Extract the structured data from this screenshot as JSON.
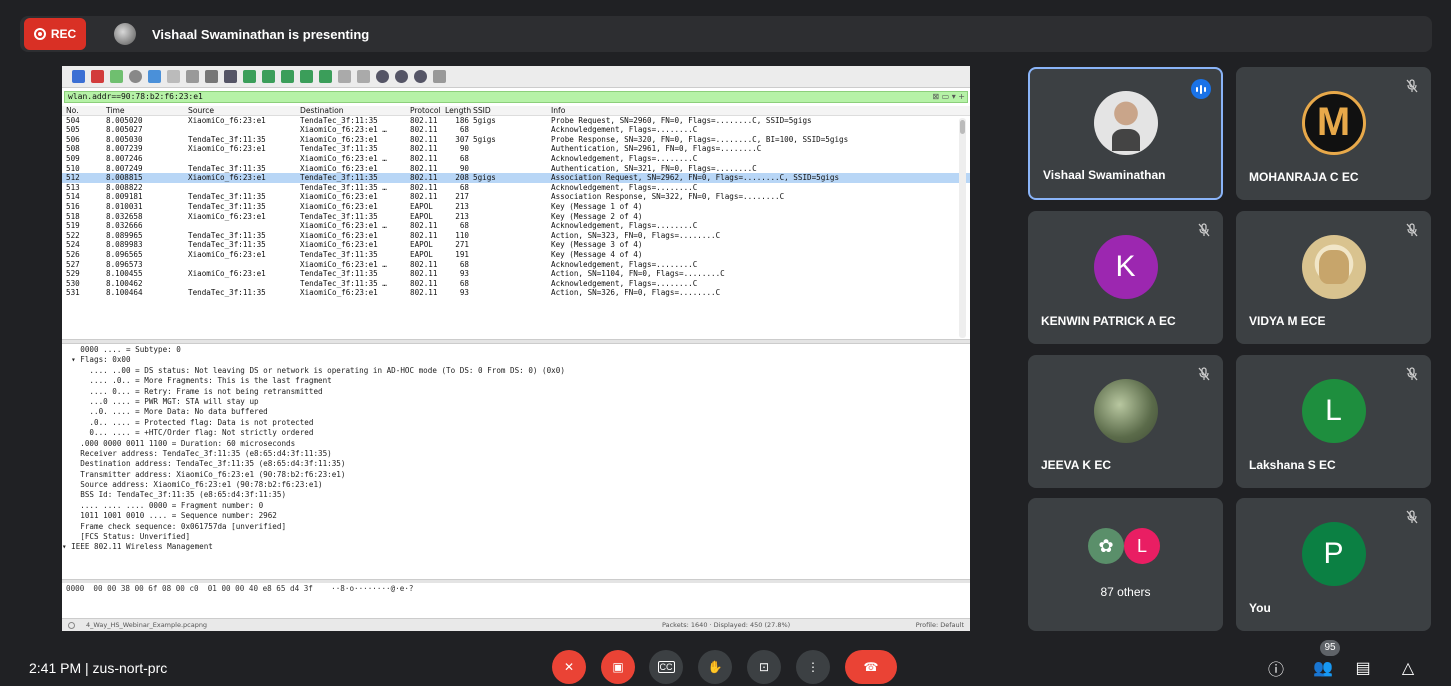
{
  "top_bar": {
    "rec_label": "REC",
    "presenting_text": "Vishaal Swaminathan is presenting"
  },
  "wireshark": {
    "filter": "wlan.addr==90:78:b2:f6:23:e1",
    "filter_end": "⊠ ▭ ▾  +",
    "columns": [
      "No.",
      "Time",
      "Source",
      "Destination",
      "Protocol",
      "Length",
      "SSID",
      "Info"
    ],
    "packets": [
      [
        "504",
        "8.005020",
        "XiaomiCo_f6:23:e1",
        "TendaTec_3f:11:35",
        "802.11",
        "186",
        "5gigs",
        "Probe Request, SN=2960, FN=0, Flags=........C, SSID=5gigs"
      ],
      [
        "505",
        "8.005027",
        "",
        "XiaomiCo_f6:23:e1 …",
        "802.11",
        "68",
        "",
        "Acknowledgement, Flags=........C"
      ],
      [
        "506",
        "8.005030",
        "TendaTec_3f:11:35",
        "XiaomiCo_f6:23:e1",
        "802.11",
        "307",
        "5gigs",
        "Probe Response, SN=320, FN=0, Flags=........C, BI=100, SSID=5gigs"
      ],
      [
        "508",
        "8.007239",
        "XiaomiCo_f6:23:e1",
        "TendaTec_3f:11:35",
        "802.11",
        "90",
        "",
        "Authentication, SN=2961, FN=0, Flags=........C"
      ],
      [
        "509",
        "8.007246",
        "",
        "XiaomiCo_f6:23:e1 …",
        "802.11",
        "68",
        "",
        "Acknowledgement, Flags=........C"
      ],
      [
        "510",
        "8.007249",
        "TendaTec_3f:11:35",
        "XiaomiCo_f6:23:e1",
        "802.11",
        "90",
        "",
        "Authentication, SN=321, FN=0, Flags=........C"
      ],
      [
        "512",
        "8.008815",
        "XiaomiCo_f6:23:e1",
        "TendaTec_3f:11:35",
        "802.11",
        "208",
        "5gigs",
        "Association Request, SN=2962, FN=0, Flags=........C, SSID=5gigs"
      ],
      [
        "513",
        "8.008822",
        "",
        "TendaTec_3f:11:35 …",
        "802.11",
        "68",
        "",
        "Acknowledgement, Flags=........C"
      ],
      [
        "514",
        "8.009181",
        "TendaTec_3f:11:35",
        "XiaomiCo_f6:23:e1",
        "802.11",
        "217",
        "",
        "Association Response, SN=322, FN=0, Flags=........C"
      ],
      [
        "516",
        "8.010031",
        "TendaTec_3f:11:35",
        "XiaomiCo_f6:23:e1",
        "EAPOL",
        "213",
        "",
        "Key (Message 1 of 4)"
      ],
      [
        "518",
        "8.032658",
        "XiaomiCo_f6:23:e1",
        "TendaTec_3f:11:35",
        "EAPOL",
        "213",
        "",
        "Key (Message 2 of 4)"
      ],
      [
        "519",
        "8.032666",
        "",
        "XiaomiCo_f6:23:e1 …",
        "802.11",
        "68",
        "",
        "Acknowledgement, Flags=........C"
      ],
      [
        "522",
        "8.089965",
        "TendaTec_3f:11:35",
        "XiaomiCo_f6:23:e1",
        "802.11",
        "110",
        "",
        "Action, SN=323, FN=0, Flags=........C"
      ],
      [
        "524",
        "8.089983",
        "TendaTec_3f:11:35",
        "XiaomiCo_f6:23:e1",
        "EAPOL",
        "271",
        "",
        "Key (Message 3 of 4)"
      ],
      [
        "526",
        "8.096565",
        "XiaomiCo_f6:23:e1",
        "TendaTec_3f:11:35",
        "EAPOL",
        "191",
        "",
        "Key (Message 4 of 4)"
      ],
      [
        "527",
        "8.096573",
        "",
        "XiaomiCo_f6:23:e1 …",
        "802.11",
        "68",
        "",
        "Acknowledgement, Flags=........C"
      ],
      [
        "529",
        "8.100455",
        "XiaomiCo_f6:23:e1",
        "TendaTec_3f:11:35",
        "802.11",
        "93",
        "",
        "Action, SN=1104, FN=0, Flags=........C"
      ],
      [
        "530",
        "8.100462",
        "",
        "TendaTec_3f:11:35 …",
        "802.11",
        "68",
        "",
        "Acknowledgement, Flags=........C"
      ],
      [
        "531",
        "8.100464",
        "TendaTec_3f:11:35",
        "XiaomiCo_f6:23:e1",
        "802.11",
        "93",
        "",
        "Action, SN=326, FN=0, Flags=........C"
      ]
    ],
    "selected_row": 6,
    "details": [
      "    0000 .... = Subtype: 0",
      "  ▾ Flags: 0x00",
      "      .... ..00 = DS status: Not leaving DS or network is operating in AD-HOC mode (To DS: 0 From DS: 0) (0x0)",
      "      .... .0.. = More Fragments: This is the last fragment",
      "      .... 0... = Retry: Frame is not being retransmitted",
      "      ...0 .... = PWR MGT: STA will stay up",
      "      ..0. .... = More Data: No data buffered",
      "      .0.. .... = Protected flag: Data is not protected",
      "      0... .... = +HTC/Order flag: Not strictly ordered",
      "    .000 0000 0011 1100 = Duration: 60 microseconds",
      "    Receiver address: TendaTec_3f:11:35 (e8:65:d4:3f:11:35)",
      "    Destination address: TendaTec_3f:11:35 (e8:65:d4:3f:11:35)",
      "    Transmitter address: XiaomiCo_f6:23:e1 (90:78:b2:f6:23:e1)",
      "    Source address: XiaomiCo_f6:23:e1 (90:78:b2:f6:23:e1)",
      "    BSS Id: TendaTec_3f:11:35 (e8:65:d4:3f:11:35)",
      "    .... .... .... 0000 = Fragment number: 0",
      "    1011 1001 0010 .... = Sequence number: 2962",
      "    Frame check sequence: 0x061757da [unverified]",
      "    [FCS Status: Unverified]",
      "▾ IEEE 802.11 Wireless Management"
    ],
    "hex_line": "0000  00 00 38 00 6f 08 00 c0  01 00 00 40 e8 65 d4 3f    ··8·o········@·e·?",
    "status_file": "4_Way_HS_Webinar_Example.pcapng",
    "status_packets": "Packets: 1640 · Displayed: 450 (27.8%)",
    "status_profile": "Profile: Default"
  },
  "participants": [
    {
      "name": "Vishaal Swaminathan",
      "avatar": "photo",
      "active": true,
      "speaking": true
    },
    {
      "name": "MOHANRAJA C EC",
      "avatar": "logo",
      "logo_text": "M",
      "muted": true
    },
    {
      "name": "KENWIN PATRICK A EC",
      "avatar": "letter",
      "letter": "K",
      "color": "#9c27b0",
      "muted": true
    },
    {
      "name": "VIDYA M ECE",
      "avatar": "ganesh",
      "muted": true
    },
    {
      "name": "JEEVA K EC",
      "avatar": "nature",
      "muted": true
    },
    {
      "name": "Lakshana S EC",
      "avatar": "letter",
      "letter": "L",
      "color": "#1e8e3e",
      "muted": true
    },
    {
      "name": "You",
      "avatar": "letter",
      "letter": "P",
      "color": "#0b8043",
      "muted": true
    }
  ],
  "others": {
    "label": "87 others",
    "letter": "L",
    "color": "#e91e63"
  },
  "bottom": {
    "clock": "2:41 PM  |  zus-nort-prc",
    "participant_count": "95",
    "cc_label": "CC"
  }
}
